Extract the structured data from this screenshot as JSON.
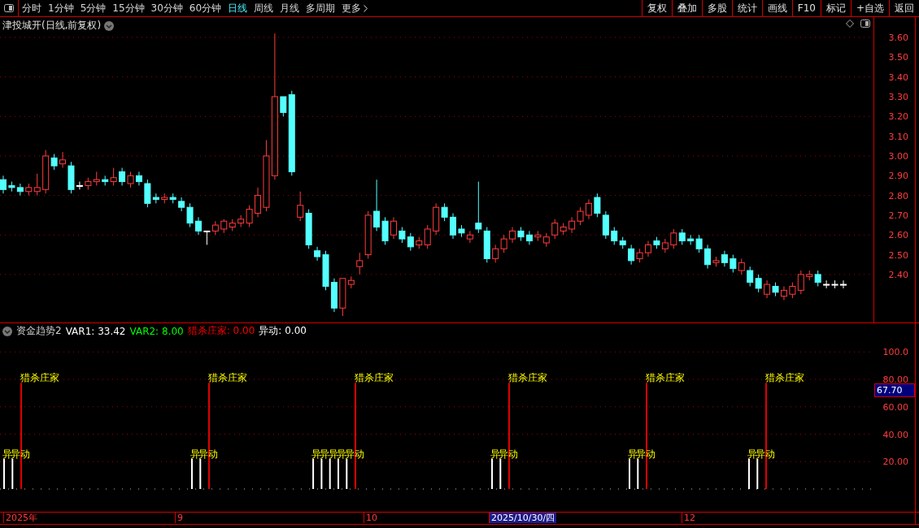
{
  "toolbar": {
    "periods": [
      {
        "label": "分时",
        "selected": false
      },
      {
        "label": "1分钟",
        "selected": false
      },
      {
        "label": "5分钟",
        "selected": false
      },
      {
        "label": "15分钟",
        "selected": false
      },
      {
        "label": "30分钟",
        "selected": false
      },
      {
        "label": "60分钟",
        "selected": false
      },
      {
        "label": "日线",
        "selected": true
      },
      {
        "label": "周线",
        "selected": false
      },
      {
        "label": "月线",
        "selected": false
      },
      {
        "label": "多周期",
        "selected": false
      },
      {
        "label": "更多",
        "selected": false
      }
    ],
    "actions": [
      "复权",
      "叠加",
      "多股",
      "统计",
      "画线",
      "F10",
      "标记",
      "+自选",
      "返回"
    ]
  },
  "price_panel": {
    "title": "津投城开(日线,前复权)",
    "chart_data": {
      "type": "candlestick",
      "ylim": [
        2.157,
        3.703
      ],
      "grid": true,
      "yticks": [
        {
          "value": 3.6,
          "label": "3.60"
        },
        {
          "value": 3.5,
          "label": "3.50"
        },
        {
          "value": 3.4,
          "label": "3.40"
        },
        {
          "value": 3.3,
          "label": "3.30"
        },
        {
          "value": 3.2,
          "label": "3.20"
        },
        {
          "value": 3.1,
          "label": "3.10"
        },
        {
          "value": 3.0,
          "label": "3.00"
        },
        {
          "value": 2.9,
          "label": "2.90"
        },
        {
          "value": 2.8,
          "label": "2.80"
        },
        {
          "value": 2.7,
          "label": "2.70"
        },
        {
          "value": 2.6,
          "label": "2.60"
        },
        {
          "value": 2.5,
          "label": "2.50"
        },
        {
          "value": 2.4,
          "label": "2.40"
        }
      ],
      "ohlc": [
        [
          2.88,
          2.9,
          2.81,
          2.83
        ],
        [
          2.85,
          2.87,
          2.82,
          2.84
        ],
        [
          2.84,
          2.86,
          2.8,
          2.82
        ],
        [
          2.82,
          2.86,
          2.8,
          2.84
        ],
        [
          2.82,
          2.91,
          2.8,
          2.84
        ],
        [
          2.83,
          3.03,
          2.81,
          3.0
        ],
        [
          2.99,
          3.01,
          2.93,
          2.95
        ],
        [
          2.96,
          3.02,
          2.94,
          2.98
        ],
        [
          2.95,
          2.97,
          2.81,
          2.83
        ],
        [
          2.85,
          2.87,
          2.83,
          2.85
        ],
        [
          2.85,
          2.89,
          2.83,
          2.87
        ],
        [
          2.87,
          2.92,
          2.85,
          2.88
        ],
        [
          2.88,
          2.9,
          2.85,
          2.87
        ],
        [
          2.87,
          2.94,
          2.85,
          2.89
        ],
        [
          2.92,
          2.94,
          2.85,
          2.87
        ],
        [
          2.86,
          2.92,
          2.84,
          2.9
        ],
        [
          2.9,
          2.92,
          2.85,
          2.87
        ],
        [
          2.86,
          2.88,
          2.74,
          2.76
        ],
        [
          2.79,
          2.81,
          2.76,
          2.78
        ],
        [
          2.78,
          2.81,
          2.76,
          2.79
        ],
        [
          2.79,
          2.81,
          2.76,
          2.78
        ],
        [
          2.77,
          2.79,
          2.72,
          2.74
        ],
        [
          2.74,
          2.76,
          2.64,
          2.66
        ],
        [
          2.67,
          2.69,
          2.6,
          2.62
        ],
        [
          2.62,
          2.62,
          2.55,
          2.62
        ],
        [
          2.62,
          2.67,
          2.6,
          2.65
        ],
        [
          2.63,
          2.68,
          2.61,
          2.67
        ],
        [
          2.64,
          2.68,
          2.62,
          2.66
        ],
        [
          2.66,
          2.7,
          2.64,
          2.68
        ],
        [
          2.66,
          2.75,
          2.64,
          2.73
        ],
        [
          2.71,
          2.84,
          2.69,
          2.8
        ],
        [
          2.74,
          3.08,
          2.72,
          3.0
        ],
        [
          2.9,
          3.62,
          2.88,
          3.3
        ],
        [
          3.3,
          3.3,
          3.2,
          3.22
        ],
        [
          3.31,
          3.33,
          2.9,
          2.92
        ],
        [
          2.69,
          2.82,
          2.67,
          2.75
        ],
        [
          2.71,
          2.73,
          2.53,
          2.55
        ],
        [
          2.52,
          2.54,
          2.47,
          2.49
        ],
        [
          2.5,
          2.52,
          2.32,
          2.34
        ],
        [
          2.36,
          2.38,
          2.21,
          2.23
        ],
        [
          2.23,
          2.38,
          2.19,
          2.38
        ],
        [
          2.35,
          2.39,
          2.33,
          2.37
        ],
        [
          2.44,
          2.51,
          2.4,
          2.47
        ],
        [
          2.5,
          2.72,
          2.48,
          2.7
        ],
        [
          2.72,
          2.88,
          2.62,
          2.64
        ],
        [
          2.67,
          2.69,
          2.55,
          2.57
        ],
        [
          2.6,
          2.69,
          2.58,
          2.67
        ],
        [
          2.62,
          2.64,
          2.56,
          2.58
        ],
        [
          2.59,
          2.61,
          2.52,
          2.54
        ],
        [
          2.55,
          2.59,
          2.53,
          2.57
        ],
        [
          2.55,
          2.65,
          2.53,
          2.63
        ],
        [
          2.62,
          2.76,
          2.6,
          2.74
        ],
        [
          2.74,
          2.76,
          2.67,
          2.69
        ],
        [
          2.69,
          2.71,
          2.58,
          2.6
        ],
        [
          2.63,
          2.65,
          2.59,
          2.61
        ],
        [
          2.58,
          2.62,
          2.56,
          2.6
        ],
        [
          2.66,
          2.87,
          2.61,
          2.63
        ],
        [
          2.62,
          2.64,
          2.46,
          2.48
        ],
        [
          2.48,
          2.55,
          2.46,
          2.53
        ],
        [
          2.53,
          2.6,
          2.51,
          2.58
        ],
        [
          2.58,
          2.64,
          2.56,
          2.62
        ],
        [
          2.62,
          2.64,
          2.57,
          2.59
        ],
        [
          2.6,
          2.62,
          2.55,
          2.57
        ],
        [
          2.59,
          2.62,
          2.57,
          2.6
        ],
        [
          2.56,
          2.61,
          2.54,
          2.59
        ],
        [
          2.6,
          2.68,
          2.58,
          2.66
        ],
        [
          2.62,
          2.66,
          2.6,
          2.64
        ],
        [
          2.63,
          2.69,
          2.61,
          2.67
        ],
        [
          2.67,
          2.74,
          2.65,
          2.72
        ],
        [
          2.7,
          2.78,
          2.68,
          2.76
        ],
        [
          2.79,
          2.81,
          2.69,
          2.71
        ],
        [
          2.7,
          2.72,
          2.58,
          2.6
        ],
        [
          2.62,
          2.64,
          2.55,
          2.57
        ],
        [
          2.57,
          2.59,
          2.53,
          2.55
        ],
        [
          2.53,
          2.55,
          2.45,
          2.47
        ],
        [
          2.48,
          2.53,
          2.46,
          2.51
        ],
        [
          2.51,
          2.57,
          2.49,
          2.55
        ],
        [
          2.57,
          2.59,
          2.53,
          2.55
        ],
        [
          2.53,
          2.58,
          2.51,
          2.56
        ],
        [
          2.55,
          2.63,
          2.53,
          2.61
        ],
        [
          2.61,
          2.63,
          2.55,
          2.57
        ],
        [
          2.58,
          2.6,
          2.55,
          2.57
        ],
        [
          2.58,
          2.6,
          2.51,
          2.53
        ],
        [
          2.53,
          2.55,
          2.43,
          2.45
        ],
        [
          2.46,
          2.49,
          2.44,
          2.47
        ],
        [
          2.5,
          2.52,
          2.44,
          2.46
        ],
        [
          2.48,
          2.5,
          2.41,
          2.43
        ],
        [
          2.42,
          2.48,
          2.4,
          2.46
        ],
        [
          2.42,
          2.44,
          2.34,
          2.36
        ],
        [
          2.38,
          2.4,
          2.31,
          2.33
        ],
        [
          2.3,
          2.37,
          2.28,
          2.35
        ],
        [
          2.34,
          2.36,
          2.29,
          2.31
        ],
        [
          2.29,
          2.34,
          2.27,
          2.32
        ],
        [
          2.3,
          2.36,
          2.28,
          2.34
        ],
        [
          2.32,
          2.42,
          2.3,
          2.4
        ],
        [
          2.39,
          2.42,
          2.37,
          2.4
        ],
        [
          2.4,
          2.42,
          2.34,
          2.36
        ],
        [
          2.35,
          2.37,
          2.33,
          2.35
        ],
        [
          2.35,
          2.37,
          2.33,
          2.35
        ],
        [
          2.35,
          2.37,
          2.33,
          2.35
        ]
      ]
    }
  },
  "indicator_panel": {
    "name": "资金趋势2",
    "readouts": [
      {
        "label": "VAR1:",
        "value": "33.42",
        "color": "#ffffff"
      },
      {
        "label": "VAR2:",
        "value": "8.00",
        "color": "#00ff00"
      },
      {
        "label": "猎杀庄家:",
        "value": "0.00",
        "color": "#ff0000"
      },
      {
        "label": "异动:",
        "value": "0.00",
        "color": "#ffffff"
      }
    ],
    "y_axis": [
      "100.0",
      "80.00",
      "60.00",
      "40.00",
      "20.00"
    ],
    "current_value": "67.70",
    "signals": [
      {
        "label": "猎杀庄家",
        "anomalies": [
          "异",
          "异动"
        ]
      },
      {
        "label": "猎杀庄家",
        "anomalies": [
          "异",
          "异动"
        ]
      },
      {
        "label": "猎杀庄家",
        "anomalies": [
          "异",
          "异",
          "异",
          "异",
          "异动"
        ]
      },
      {
        "label": "猎杀庄家",
        "anomalies": [
          "异",
          "异动"
        ]
      },
      {
        "label": "猎杀庄家",
        "anomalies": [
          "异",
          "异动"
        ]
      },
      {
        "label": "猎杀庄家",
        "anomalies": [
          "异",
          "异动"
        ]
      }
    ]
  },
  "time_axis": {
    "labels": [
      {
        "text": "2025年",
        "selected": false
      },
      {
        "text": "9",
        "selected": false
      },
      {
        "text": "10",
        "selected": false
      },
      {
        "text": "2025/10/30/四",
        "selected": true
      },
      {
        "text": "12",
        "selected": false
      }
    ]
  }
}
